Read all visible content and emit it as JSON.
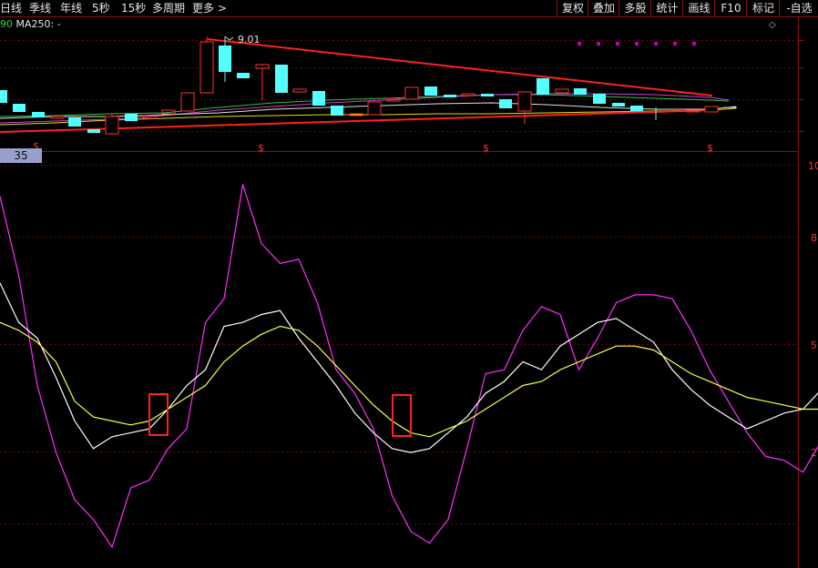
{
  "toolbar": {
    "periods": [
      "日线",
      "季线",
      "年线",
      "5秒",
      "15秒",
      "多周期",
      "更多 >"
    ],
    "tools": [
      "复权",
      "叠加",
      "多股",
      "统计",
      "画线",
      "F10",
      "标记",
      "-自选"
    ]
  },
  "legend": {
    "ma_value_fragment": "90",
    "ma_label": "MA250: -"
  },
  "price_panel": {
    "high_marker": "9.01",
    "dividend_marker": "$",
    "right_axis_labels": [
      "10",
      "8",
      "5",
      "2"
    ]
  },
  "indicator_panel": {
    "period_badge": "35"
  },
  "colors": {
    "rise": "#ff3030",
    "fall": "#54ffff",
    "trend_line": "#ff2020",
    "k_line": "#ffffff",
    "d_line": "#ffff40",
    "j_line": "#ff30ff",
    "grid": "#7a0000",
    "highlight_box": "#ff2020"
  },
  "chart_data": {
    "type": "line",
    "title": "",
    "series": [
      {
        "values": [
          92,
          72,
          44,
          27,
          15,
          10,
          3,
          18,
          20,
          28,
          33,
          60,
          66,
          95,
          80,
          75,
          76,
          65,
          48,
          42,
          33,
          16,
          7,
          4,
          10,
          28,
          47,
          48,
          58,
          64,
          62,
          48,
          56,
          65,
          67,
          67,
          66,
          58,
          48,
          40,
          32,
          26,
          25,
          22,
          30
        ]
      },
      {
        "values": [
          70,
          60,
          56,
          46,
          35,
          28,
          31,
          32,
          33,
          38,
          44,
          48,
          59,
          60,
          62,
          63,
          56,
          50,
          44,
          37,
          32,
          28,
          27,
          28,
          32,
          36,
          42,
          45,
          50,
          48,
          54,
          57,
          60,
          61,
          58,
          55,
          48,
          43,
          39,
          36,
          33,
          35,
          37,
          38,
          43
        ]
      },
      {
        "values": [
          60,
          58,
          55,
          50,
          40,
          36,
          35,
          34,
          35,
          38,
          41,
          44,
          50,
          54,
          57,
          59,
          58,
          54,
          49,
          44,
          39,
          35,
          32,
          31,
          33,
          35,
          38,
          41,
          44,
          45,
          48,
          50,
          52,
          54,
          54,
          53,
          50,
          47,
          45,
          43,
          41,
          40,
          39,
          38,
          38
        ]
      }
    ]
  }
}
